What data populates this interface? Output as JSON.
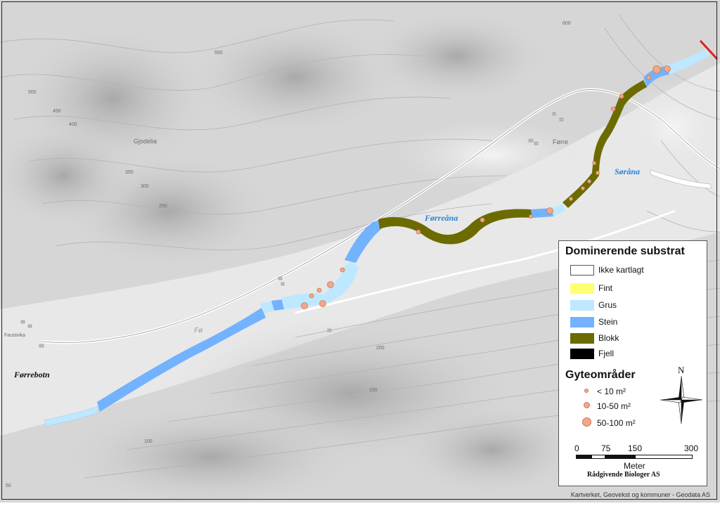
{
  "map": {
    "place_names": {
      "gjodelia": "Gjodelia",
      "forre": "Førre",
      "forrebotn": "Førrebotn",
      "faustvika": "Faustvika",
      "fo": "Fø"
    },
    "rivers": {
      "forreana": "Førreåna",
      "sorana": "Søråna"
    },
    "contour_labels": [
      "500",
      "450",
      "400",
      "350",
      "300",
      "250",
      "200",
      "150",
      "100",
      "50",
      "550",
      "600"
    ],
    "credit": "Kartverket, Geovekst og kommuner - Geodata AS"
  },
  "legend": {
    "substrate_title": "Dominerende substrat",
    "substrate_items": [
      {
        "label": "Ikke kartlagt",
        "color": "#ffffff"
      },
      {
        "label": "Fint",
        "color": "#ffff73"
      },
      {
        "label": "Grus",
        "color": "#bee8ff"
      },
      {
        "label": "Stein",
        "color": "#73b2ff"
      },
      {
        "label": "Blokk",
        "color": "#6b6b00"
      },
      {
        "label": "Fjell",
        "color": "#000000"
      }
    ],
    "spawning_title": "Gyteområder",
    "spawning_items": [
      {
        "label": "< 10 m²"
      },
      {
        "label": "10-50 m²"
      },
      {
        "label": "50-100 m²"
      }
    ],
    "spawning_color": "#f0a888",
    "north": "N",
    "scale_ticks": [
      "0",
      "75",
      "150",
      "300"
    ],
    "scale_unit": "Meter",
    "author": "Rådgivende Biologer AS"
  }
}
